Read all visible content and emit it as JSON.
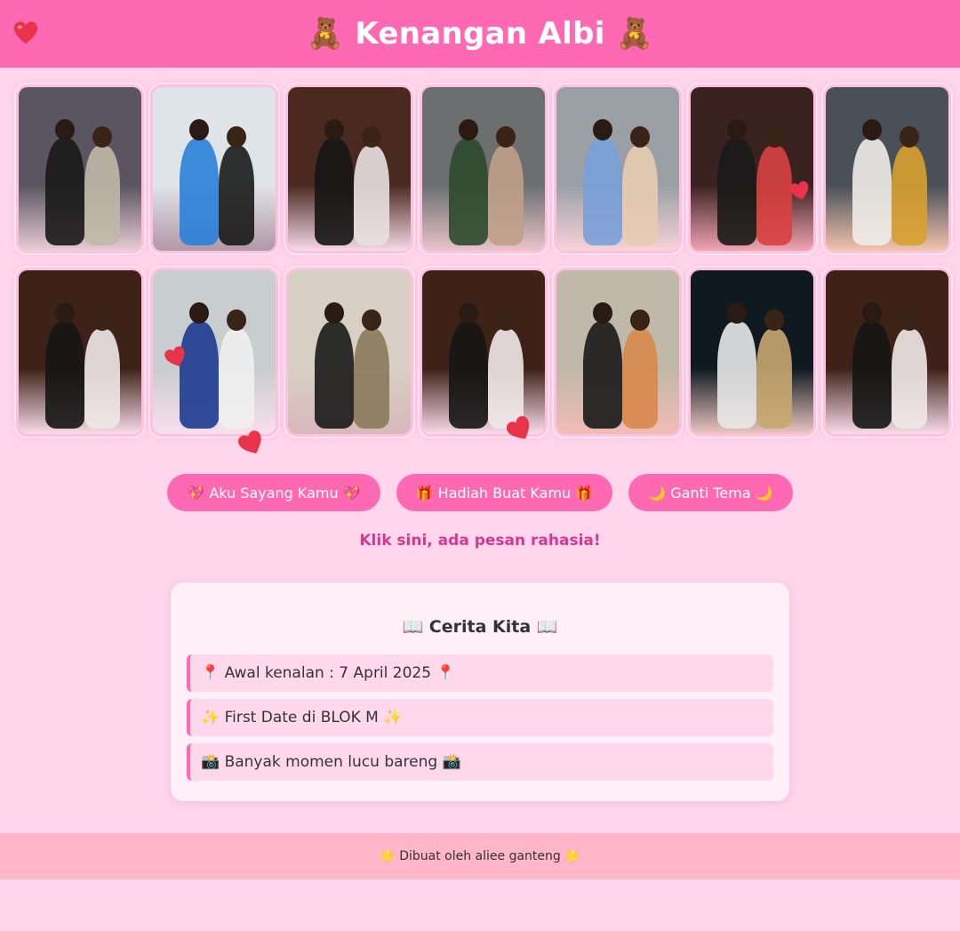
{
  "header": {
    "title": "🧸 Kenangan Albi 🧸"
  },
  "gallery": {
    "photos": [
      {
        "bg": "#5a5560",
        "fig": "#1a1a1a",
        "accent": "#c0b9a8"
      },
      {
        "bg": "#dfe4e8",
        "fig": "#2a7fd8",
        "accent": "#1a1a1a"
      },
      {
        "bg": "#4a2a20",
        "fig": "#151515",
        "accent": "#e8e0e0"
      },
      {
        "bg": "#6b6f70",
        "fig": "#2e4a2e",
        "accent": "#c0a08a"
      },
      {
        "bg": "#9aa0a6",
        "fig": "#7aa0d8",
        "accent": "#e8cbb0"
      },
      {
        "bg": "#3a2220",
        "fig": "#1a1a1a",
        "accent": "#d84040"
      },
      {
        "bg": "#4a5058",
        "fig": "#f0ece8",
        "accent": "#d8a030"
      },
      {
        "bg": "#3e2218",
        "fig": "#151515",
        "accent": "#f0e8e8"
      },
      {
        "bg": "#c8cdd0",
        "fig": "#1d3b8f",
        "accent": "#f0f0f0"
      },
      {
        "bg": "#d8d0c4",
        "fig": "#1a1a1a",
        "accent": "#8a7a5a"
      },
      {
        "bg": "#3e2218",
        "fig": "#151515",
        "accent": "#f0e8e8"
      },
      {
        "bg": "#c0b8a8",
        "fig": "#1a1a1a",
        "accent": "#d8884a"
      },
      {
        "bg": "#0f1a20",
        "fig": "#e8e8e8",
        "accent": "#c8a870"
      },
      {
        "bg": "#3e2218",
        "fig": "#151515",
        "accent": "#f0e8e8"
      }
    ]
  },
  "buttons": {
    "love": "💖 Aku Sayang Kamu 💖",
    "gift": "🎁 Hadiah Buat Kamu 🎁",
    "theme": "🌙 Ganti Tema 🌙"
  },
  "secret_link": "Klik sini, ada pesan rahasia!",
  "story": {
    "title": "📖 Cerita Kita 📖",
    "items": [
      "📍 Awal kenalan : 7 April 2025 📍",
      "✨ First Date di BLOK M ✨",
      "📸 Banyak momen lucu bareng 📸"
    ]
  },
  "footer": {
    "text": "🌟 Dibuat oleh aliee ganteng 🌟"
  },
  "colors": {
    "primary": "#ff69b4",
    "background": "#ffd6ec",
    "footer": "#ffb6c9",
    "secret": "#d6388e",
    "heart": "#e8334a"
  }
}
